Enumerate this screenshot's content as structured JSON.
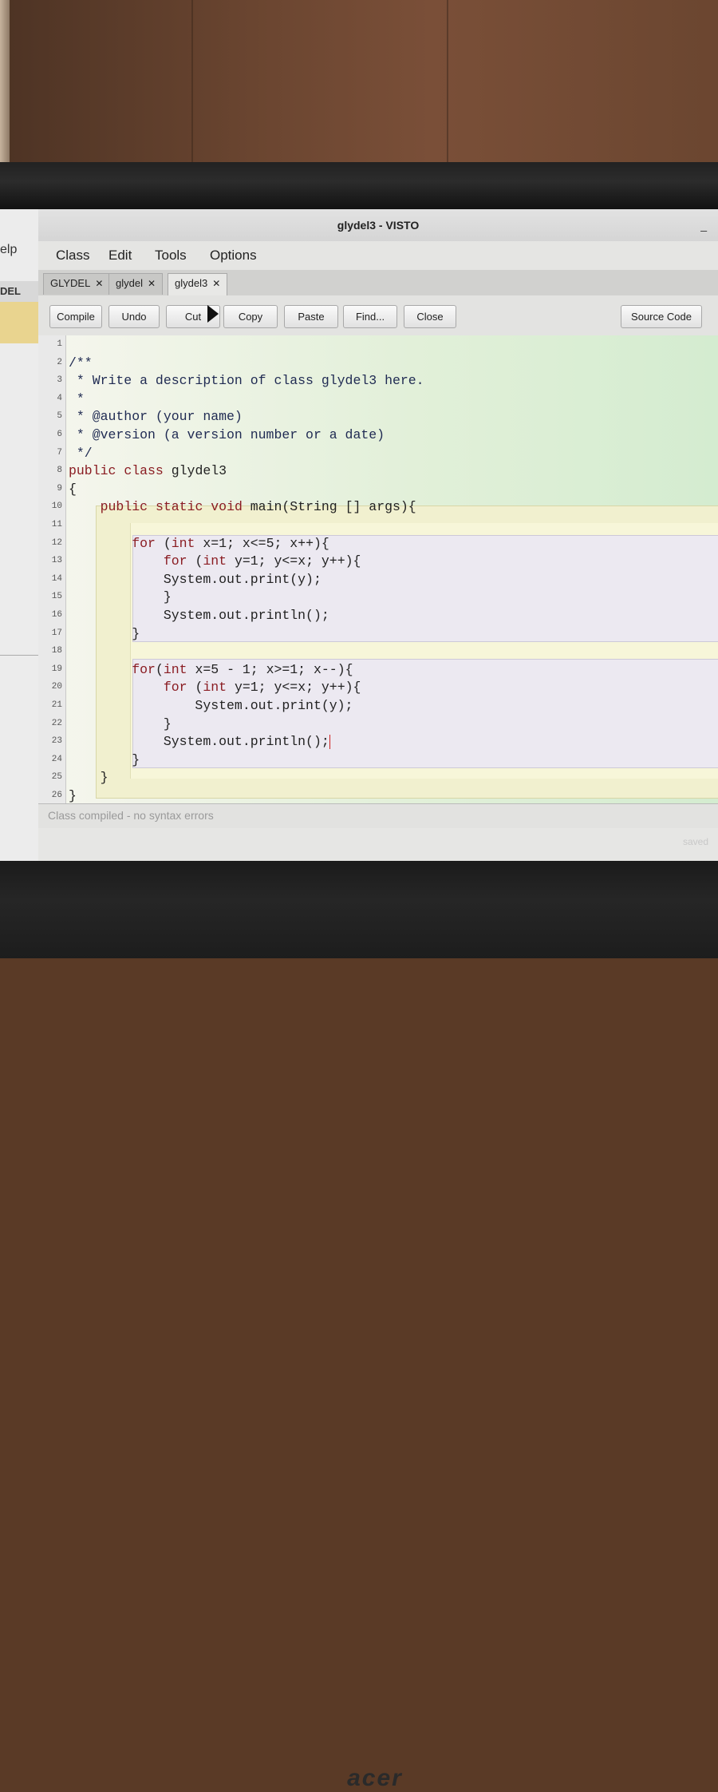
{
  "window": {
    "title": "glydel3 - VISTO",
    "minimize_glyph": "_"
  },
  "background_window": {
    "menu_fragment": "elp",
    "tab_fragment": "DEL"
  },
  "menu": {
    "items": [
      "Class",
      "Edit",
      "Tools",
      "Options"
    ]
  },
  "tabs": [
    {
      "label": "GLYDEL",
      "close": "✕"
    },
    {
      "label": "glydel",
      "close": "✕"
    },
    {
      "label": "glydel3",
      "close": "✕",
      "active": true
    }
  ],
  "toolbar": {
    "compile": "Compile",
    "undo": "Undo",
    "cut": "Cut",
    "copy": "Copy",
    "paste": "Paste",
    "find": "Find...",
    "close": "Close",
    "view_mode": "Source Code"
  },
  "editor": {
    "line_numbers": [
      "1",
      "2",
      "3",
      "4",
      "5",
      "6",
      "7",
      "8",
      "9",
      "10",
      "11",
      "12",
      "13",
      "14",
      "15",
      "16",
      "17",
      "18",
      "19",
      "20",
      "21",
      "22",
      "23",
      "24",
      "25",
      "26"
    ],
    "lines": [
      "",
      "/**",
      " * Write a description of class glydel3 here.",
      " *",
      " * @author (your name)",
      " * @version (a version number or a date)",
      " */",
      "public class glydel3",
      "{",
      "    public static void main(String [] args){",
      "",
      "        for (int x=1; x<=5; x++){",
      "            for (int y=1; y<=x; y++){",
      "            System.out.print(y);",
      "            }",
      "            System.out.println();",
      "        }",
      "",
      "        for(int x=5 - 1; x>=1; x--){",
      "            for (int y=1; y<=x; y++){",
      "                System.out.print(y);",
      "            }",
      "            System.out.println();",
      "        }",
      "    }",
      "}"
    ]
  },
  "status": {
    "message": "Class compiled - no syntax errors",
    "saved": "saved"
  },
  "bezel": {
    "brand": "acer"
  },
  "colors": {
    "keyword": "#8a1c22",
    "comment": "#1f2a52",
    "method_block": "#f7f6d9",
    "loop_block": "#ece9f1",
    "caret": "#d02020"
  }
}
